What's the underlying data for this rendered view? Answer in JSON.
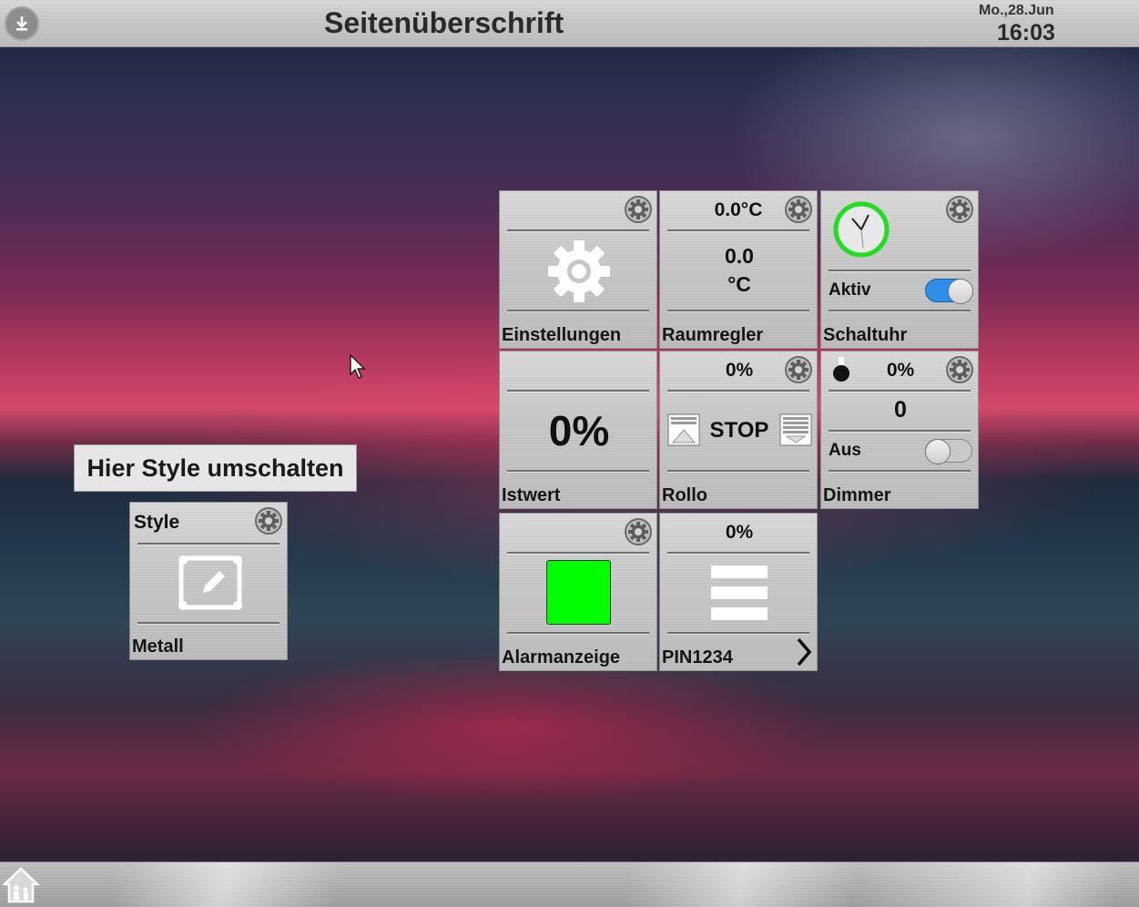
{
  "header": {
    "title": "Seitenüberschrift",
    "date": "Mo.,28.Jun",
    "time": "16:03",
    "download_icon": "download-icon"
  },
  "footer": {
    "home_icon": "home-icon"
  },
  "tooltip": {
    "text": "Hier Style umschalten"
  },
  "style_tile": {
    "title": "Style",
    "value": "Metall",
    "icon": "edit-frame-icon"
  },
  "tiles": {
    "einstellungen": {
      "label": "Einstellungen",
      "icon": "gear-icon"
    },
    "raumregler": {
      "label": "Raumregler",
      "setpoint": "0.0°C",
      "value": "0.0",
      "unit": "°C"
    },
    "schaltuhr": {
      "label": "Schaltuhr",
      "state_label": "Aktiv",
      "toggle_on": true,
      "icon": "clock-icon"
    },
    "istwert": {
      "label": "Istwert",
      "value": "0%"
    },
    "rollo": {
      "label": "Rollo",
      "position": "0%",
      "stop_label": "STOP"
    },
    "dimmer": {
      "label": "Dimmer",
      "percent": "0%",
      "value": "0",
      "state_label": "Aus",
      "toggle_on": false
    },
    "alarmanzeige": {
      "label": "Alarmanzeige",
      "status_color": "#00ff00"
    },
    "pin": {
      "label": "PIN1234",
      "percent": "0%"
    }
  }
}
